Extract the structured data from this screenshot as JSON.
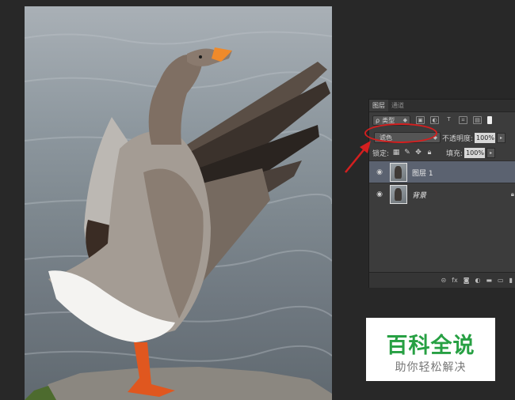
{
  "layers_panel": {
    "tabs": [
      "图层",
      "通道"
    ],
    "filter_kind": "类型",
    "blend_mode": "滤色",
    "opacity_label": "不透明度:",
    "opacity_value": "100%",
    "lock_label": "锁定:",
    "fill_label": "填充:",
    "fill_value": "100%",
    "layers": [
      {
        "name": "图层 1",
        "selected": true
      },
      {
        "name": "背景",
        "selected": false
      }
    ],
    "footer_fx": "fx"
  },
  "watermark": {
    "title": "百科全说",
    "subtitle": "助你轻松解决"
  },
  "colors": {
    "annotation": "#d41f1f",
    "watermark_green": "#27a043",
    "selected_layer": "#5b6270"
  }
}
